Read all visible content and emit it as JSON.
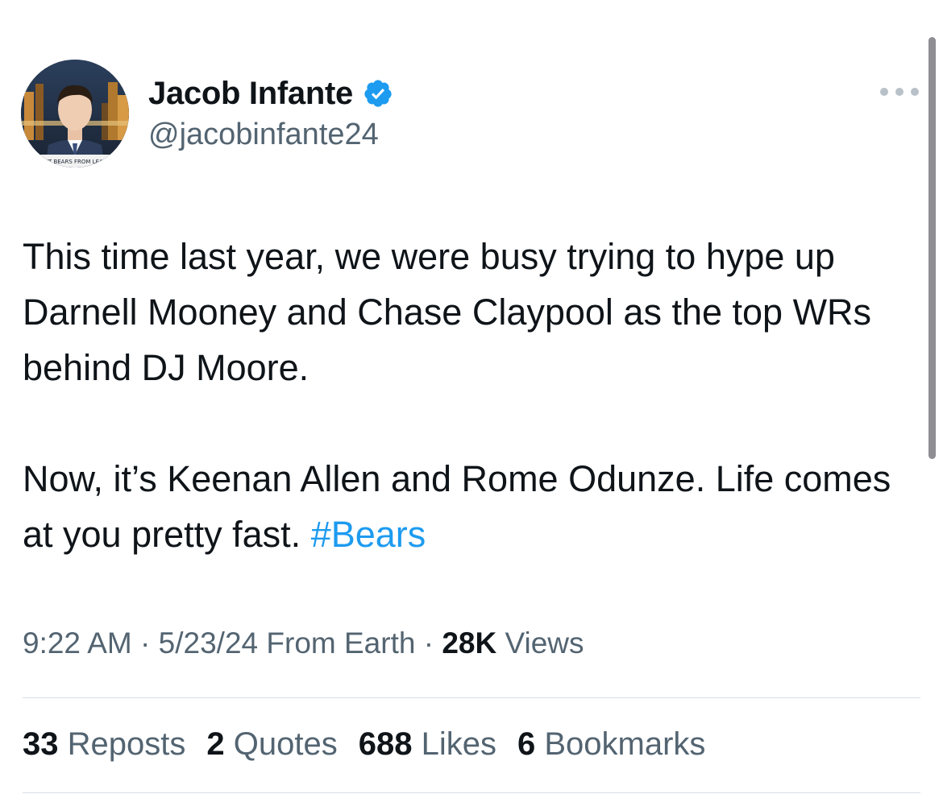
{
  "author": {
    "display_name": "Jacob Infante",
    "handle": "@jacobinfante24",
    "verified": true,
    "verified_color": "#1d9bf0",
    "avatar_caption": "PREVENT BEARS FROM LEAV"
  },
  "tweet": {
    "paragraphs": [
      "This time last year, we were busy trying to hype up Darnell Mooney and Chase Claypool as the top WRs behind DJ Moore.",
      "Now, it’s Keenan Allen and Rome Odunze. Life comes at you pretty fast."
    ],
    "hashtag": "#Bears",
    "hashtag_color": "#1d9bf0"
  },
  "meta": {
    "time": "9:22 AM",
    "separator": "·",
    "date": "5/23/24",
    "source": "From Earth",
    "views_count": "28K",
    "views_label": "Views"
  },
  "stats": {
    "reposts": {
      "count": "33",
      "label": "Reposts"
    },
    "quotes": {
      "count": "2",
      "label": "Quotes"
    },
    "likes": {
      "count": "688",
      "label": "Likes"
    },
    "bookmarks": {
      "count": "6",
      "label": "Bookmarks"
    }
  },
  "icons": {
    "more": "more-options-icon",
    "verified": "verified-badge-icon"
  }
}
